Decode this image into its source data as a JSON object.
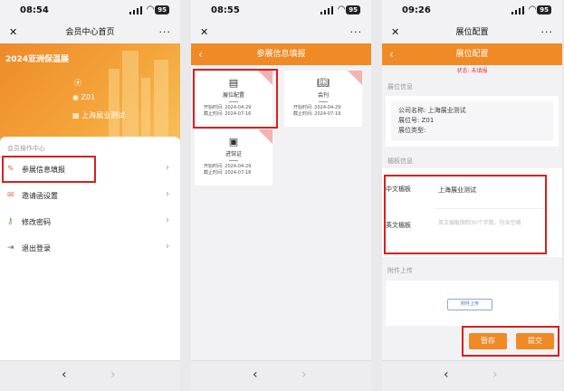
{
  "status_bars": [
    {
      "time": "08:54",
      "battery": "95"
    },
    {
      "time": "08:55",
      "battery": "95"
    },
    {
      "time": "09:26",
      "battery": "95"
    }
  ],
  "screen1": {
    "nav_title": "会员中心首页",
    "banner_title": "2024亚洲保温展",
    "booth": "Z01",
    "company": "上海展业测试",
    "menu_header": "会员操作中心",
    "menu": [
      {
        "label": "参展信息填报",
        "icon": "edit-icon"
      },
      {
        "label": "邀请函设置",
        "icon": "mail-icon"
      },
      {
        "label": "修改密码",
        "icon": "key-icon"
      },
      {
        "label": "退出登录",
        "icon": "logout-icon"
      }
    ]
  },
  "screen2": {
    "nav_title": "参展信息填报",
    "tiles": [
      {
        "name": "展位配置",
        "start_label": "开始时间:",
        "start": "2024-04-29",
        "end_label": "截止时间:",
        "end": "2024-07-16"
      },
      {
        "name": "会刊",
        "start_label": "开始时间:",
        "start": "2024-04-29",
        "end_label": "截止时间:",
        "end": "2024-07-19"
      },
      {
        "name": "进馆证",
        "start_label": "开始时间:",
        "start": "2024-04-29",
        "end_label": "截止时间:",
        "end": "2024-07-18"
      }
    ]
  },
  "screen3": {
    "nav_title": "展位配置",
    "orange_title": "展位配置",
    "status_text": "状态: 未填报",
    "booth_section": "展位信息",
    "company_label": "公司名称:",
    "company_value": "上海展业测试",
    "booth_label": "展位号:",
    "booth_value": "Z01",
    "booth_type_label": "展位类型:",
    "fascia_section": "楣板信息",
    "cn_label": "中文楣板",
    "cn_value": "上海展业测试",
    "en_label": "英文楣板",
    "en_placeholder": "英文楣板限制30个字数，包含空格",
    "attach_section": "附件上传",
    "upload_label": "附件上传",
    "save_label": "暂存",
    "submit_label": "提交"
  },
  "colors": {
    "accent": "#f08a26",
    "highlight": "#d81f1f"
  }
}
